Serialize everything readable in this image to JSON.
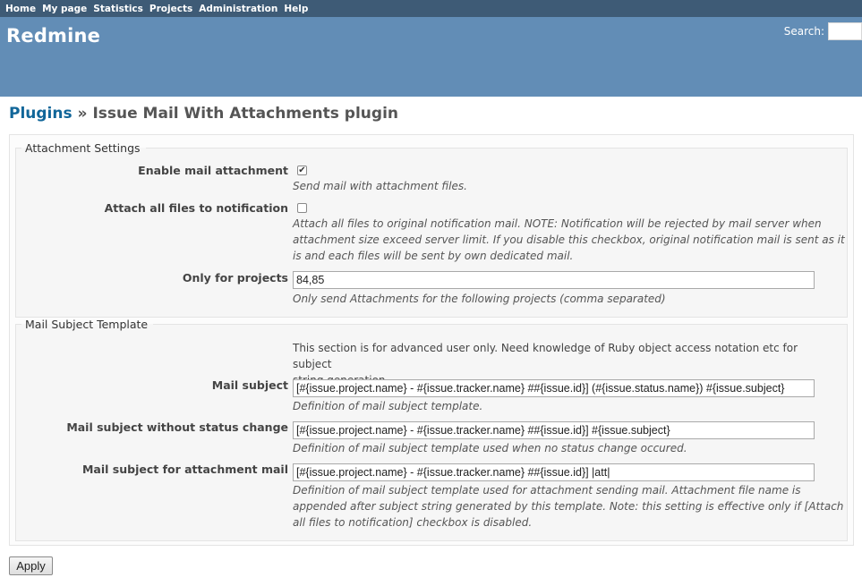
{
  "top_menu": [
    "Home",
    "My page",
    "Statistics",
    "Projects",
    "Administration",
    "Help"
  ],
  "header": {
    "title": "Redmine",
    "search_label": "Search:"
  },
  "page_title": {
    "link": "Plugins",
    "separator": " » ",
    "current": "Issue Mail With Attachments plugin"
  },
  "attachment_settings": {
    "legend": "Attachment Settings",
    "enable_label": "Enable mail attachment",
    "enable_checked": true,
    "enable_hint": "Send mail with attachment files.",
    "attach_all_label": "Attach all files to notification",
    "attach_all_checked": false,
    "attach_all_hint_1": "Attach all files to original notification mail. NOTE: Notification will be rejected by mail server when",
    "attach_all_hint_2": "attachment size exceed server limit. If you disable this checkbox, original notification mail is sent as it",
    "attach_all_hint_3": "is and each files will be sent by own dedicated mail.",
    "projects_label": "Only for projects",
    "projects_value": "84,85",
    "projects_hint": "Only send Attachments for the following projects (comma separated)"
  },
  "mail_subject_template": {
    "legend": "Mail Subject Template",
    "intro_1": "This section is for advanced user only. Need knowledge of Ruby object access notation etc for subject",
    "intro_2": "string generation.",
    "subject_label": "Mail subject",
    "subject_value": "[#{issue.project.name} - #{issue.tracker.name} ##{issue.id}] (#{issue.status.name}) #{issue.subject}",
    "subject_hint": "Definition of mail subject template.",
    "no_status_label": "Mail subject without status change",
    "no_status_value": "[#{issue.project.name} - #{issue.tracker.name} ##{issue.id}] #{issue.subject}",
    "no_status_hint": "Definition of mail subject template used when no status change occured.",
    "attachment_label": "Mail subject for attachment mail",
    "attachment_value": "[#{issue.project.name} - #{issue.tracker.name} ##{issue.id}] |att|",
    "attachment_hint_1": "Definition of mail subject template used for attachment sending mail. Attachment file name is",
    "attachment_hint_2": "appended after subject string generated by this template. Note: this setting is effective only if [Attach",
    "attachment_hint_3": "all files to notification] checkbox is disabled."
  },
  "apply_label": "Apply"
}
